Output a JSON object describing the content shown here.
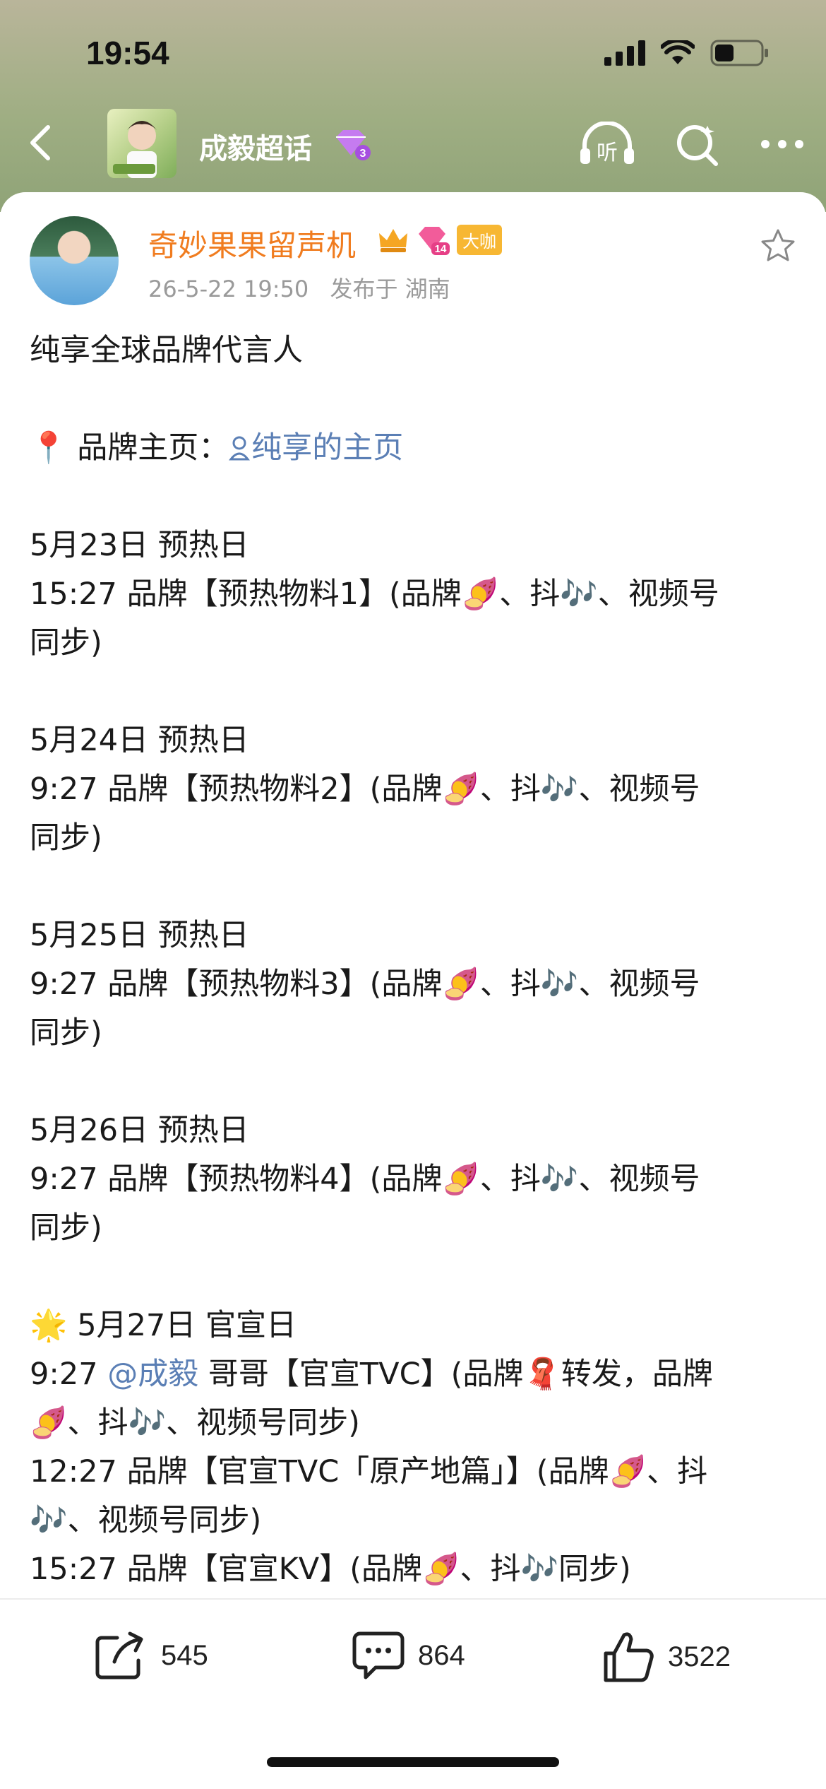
{
  "status": {
    "time": "19:54"
  },
  "nav": {
    "title": "成毅超话",
    "level_badge": "3",
    "listen_label": "听"
  },
  "post": {
    "username": "奇妙果果留声机",
    "user_level": "14",
    "bigv_label": "大咖",
    "date": "26-5-22 19:50",
    "location": "发布于 湖南",
    "lines": {
      "l1": "纯享全球品牌代言人",
      "l2_prefix": "📍 品牌主页：",
      "l2_link": "纯享的主页",
      "l3": "5月23日 预热日",
      "l4a": "15:27 品牌【预热物料1】(品牌🍠、抖🎶、视频号",
      "l4b": "同步)",
      "l5": "5月24日 预热日",
      "l6a": "9:27 品牌【预热物料2】(品牌🍠、抖🎶、视频号",
      "l6b": "同步)",
      "l7": "5月25日 预热日",
      "l8a": "9:27 品牌【预热物料3】(品牌🍠、抖🎶、视频号",
      "l8b": "同步)",
      "l9": "5月26日 预热日",
      "l10a": "9:27 品牌【预热物料4】(品牌🍠、抖🎶、视频号",
      "l10b": "同步)",
      "l11": "🌟 5月27日 官宣日",
      "l12_time": "9:27 ",
      "l12_mention": "@成毅",
      "l12_rest": " 哥哥【官宣TVC】(品牌🧣转发，品牌",
      "l12b": "🍠、抖🎶、视频号同步)",
      "l13a": "12:27 品牌【官宣TVC「原产地篇」】(品牌🍠、抖",
      "l13b": "🎶、视频号同步)",
      "l14": "15:27 品牌【官宣KV】(品牌🍠、抖🎶同步)"
    }
  },
  "actions": {
    "repost": "545",
    "comment": "864",
    "like": "3522"
  }
}
